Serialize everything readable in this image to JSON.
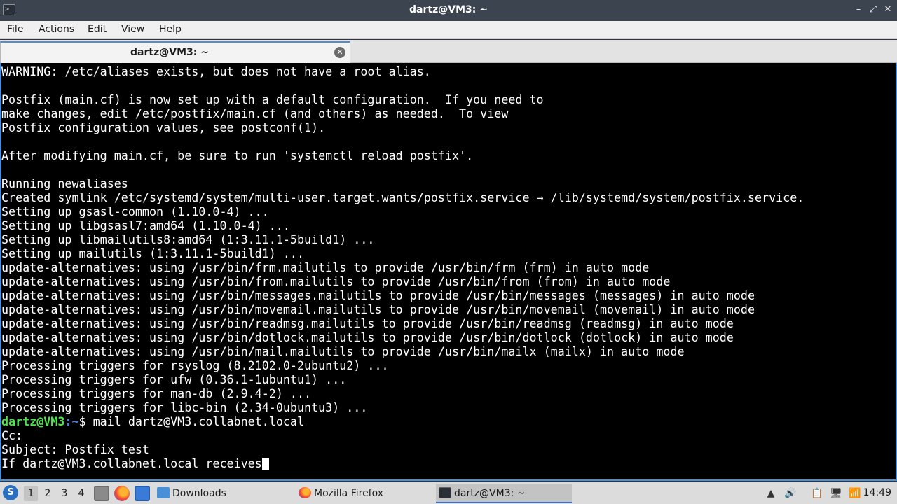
{
  "window": {
    "title": "dartz@VM3: ~",
    "app_icon": ">_",
    "controls": {
      "minimize": "–",
      "maximize": "⤢",
      "close": "✕"
    }
  },
  "menu": {
    "items": [
      "File",
      "Actions",
      "Edit",
      "View",
      "Help"
    ]
  },
  "tab": {
    "label": "dartz@VM3: ~",
    "close_glyph": "✕"
  },
  "terminal": {
    "lines": [
      "WARNING: /etc/aliases exists, but does not have a root alias.",
      "",
      "Postfix (main.cf) is now set up with a default configuration.  If you need to",
      "make changes, edit /etc/postfix/main.cf (and others) as needed.  To view",
      "Postfix configuration values, see postconf(1).",
      "",
      "After modifying main.cf, be sure to run 'systemctl reload postfix'.",
      "",
      "Running newaliases",
      "Created symlink /etc/systemd/system/multi-user.target.wants/postfix.service → /lib/systemd/system/postfix.service.",
      "Setting up gsasl-common (1.10.0-4) ...",
      "Setting up libgsasl7:amd64 (1.10.0-4) ...",
      "Setting up libmailutils8:amd64 (1:3.11.1-5build1) ...",
      "Setting up mailutils (1:3.11.1-5build1) ...",
      "update-alternatives: using /usr/bin/frm.mailutils to provide /usr/bin/frm (frm) in auto mode",
      "update-alternatives: using /usr/bin/from.mailutils to provide /usr/bin/from (from) in auto mode",
      "update-alternatives: using /usr/bin/messages.mailutils to provide /usr/bin/messages (messages) in auto mode",
      "update-alternatives: using /usr/bin/movemail.mailutils to provide /usr/bin/movemail (movemail) in auto mode",
      "update-alternatives: using /usr/bin/readmsg.mailutils to provide /usr/bin/readmsg (readmsg) in auto mode",
      "update-alternatives: using /usr/bin/dotlock.mailutils to provide /usr/bin/dotlock (dotlock) in auto mode",
      "update-alternatives: using /usr/bin/mail.mailutils to provide /usr/bin/mailx (mailx) in auto mode",
      "Processing triggers for rsyslog (8.2102.0-2ubuntu2) ...",
      "Processing triggers for ufw (0.36.1-1ubuntu1) ...",
      "Processing triggers for man-db (2.9.4-2) ...",
      "Processing triggers for libc-bin (2.34-0ubuntu3) ..."
    ],
    "prompt": {
      "user_host": "dartz@VM3",
      "path": ":~",
      "symbol": "$",
      "command": " mail dartz@VM3.collabnet.local"
    },
    "after_prompt": [
      "Cc:",
      "Subject: Postfix test"
    ],
    "current_input": "If dartz@VM3.collabnet.local receives"
  },
  "taskbar": {
    "start_glyph": "S",
    "workspaces": [
      "1",
      "2",
      "3",
      "4"
    ],
    "active_workspace": "1",
    "tasks": [
      {
        "label": "Downloads",
        "icon": "folder-icon"
      },
      {
        "label": "Mozilla Firefox",
        "icon": "firefox-icon"
      },
      {
        "label": "dartz@VM3: ~",
        "icon": "terminal-icon",
        "active": true
      }
    ],
    "tray": [
      "▲",
      "🔊",
      "📋",
      "🖥",
      "📶"
    ],
    "clock": "14:49"
  },
  "colors": {
    "accent": "#4a90d9",
    "prompt_user": "#4ee44e",
    "prompt_path": "#4a7ee8",
    "terminal_bg": "#000000"
  }
}
